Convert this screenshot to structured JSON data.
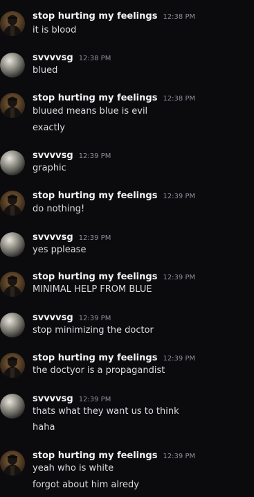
{
  "colors": {
    "background": "#0b0b0e",
    "username": "#f2f3f5",
    "timestamp": "#8e9098",
    "message_text": "#dcdde0"
  },
  "messages": [
    {
      "author": "stop hurting my feelings",
      "time": "12:38 PM",
      "avatar": "dark-figure-avatar",
      "lines": [
        "it is blood"
      ]
    },
    {
      "author": "svvvvsg",
      "time": "12:38 PM",
      "avatar": "grey-sphere-avatar",
      "lines": [
        "blued"
      ]
    },
    {
      "author": "stop hurting my feelings",
      "time": "12:38 PM",
      "avatar": "dark-figure-avatar",
      "lines": [
        "bluued means blue is evil",
        "exactly"
      ]
    },
    {
      "author": "svvvvsg",
      "time": "12:39 PM",
      "avatar": "grey-sphere-avatar",
      "lines": [
        "graphic"
      ]
    },
    {
      "author": "stop hurting my feelings",
      "time": "12:39 PM",
      "avatar": "dark-figure-avatar",
      "lines": [
        "do nothing!"
      ]
    },
    {
      "author": "svvvvsg",
      "time": "12:39 PM",
      "avatar": "grey-sphere-avatar",
      "lines": [
        "yes pplease"
      ]
    },
    {
      "author": "stop hurting my feelings",
      "time": "12:39 PM",
      "avatar": "dark-figure-avatar",
      "lines": [
        "MINIMAL HELP FROM BLUE"
      ]
    },
    {
      "author": "svvvvsg",
      "time": "12:39 PM",
      "avatar": "grey-sphere-avatar",
      "lines": [
        "stop minimizing the doctor"
      ]
    },
    {
      "author": "stop hurting my feelings",
      "time": "12:39 PM",
      "avatar": "dark-figure-avatar",
      "lines": [
        "the doctyor is a propagandist"
      ]
    },
    {
      "author": "svvvvsg",
      "time": "12:39 PM",
      "avatar": "grey-sphere-avatar",
      "lines": [
        "thats what they want us to think",
        "haha"
      ]
    },
    {
      "author": "stop hurting my feelings",
      "time": "12:39 PM",
      "avatar": "dark-figure-avatar",
      "lines": [
        "yeah who is white",
        "forgot about him alredy"
      ]
    }
  ]
}
